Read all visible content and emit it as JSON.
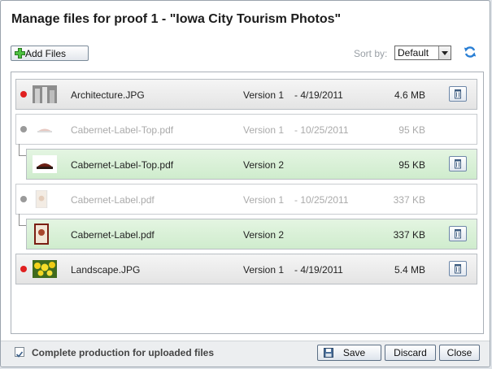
{
  "dialog": {
    "title": "Manage files for proof 1 - \"Iowa City Tourism Photos\""
  },
  "toolbar": {
    "add_files_label": "Add Files",
    "sort_label": "Sort by:",
    "sort_value": "Default"
  },
  "files": [
    {
      "name": "Architecture.JPG",
      "version": "Version 1",
      "date": "-  4/19/2011",
      "size": "4.6 MB",
      "status": "red",
      "state": "current"
    },
    {
      "name": "Cabernet-Label-Top.pdf",
      "version": "Version 1",
      "date": "-  10/25/2011",
      "size": "95 KB",
      "status": "grey",
      "state": "superseded"
    },
    {
      "name": "Cabernet-Label-Top.pdf",
      "version": "Version 2",
      "date": "",
      "size": "95 KB",
      "status": "",
      "state": "new"
    },
    {
      "name": "Cabernet-Label.pdf",
      "version": "Version 1",
      "date": "-  10/25/2011",
      "size": "337 KB",
      "status": "grey",
      "state": "superseded"
    },
    {
      "name": "Cabernet-Label.pdf",
      "version": "Version 2",
      "date": "",
      "size": "337 KB",
      "status": "",
      "state": "new"
    },
    {
      "name": "Landscape.JPG",
      "version": "Version 1",
      "date": "-  4/19/2011",
      "size": "5.4 MB",
      "status": "red",
      "state": "current"
    }
  ],
  "footer": {
    "checkbox_label": "Complete production for uploaded files",
    "checkbox_checked": true,
    "save_label": "Save",
    "discard_label": "Discard",
    "close_label": "Close"
  },
  "colors": {
    "status_red": "#e02020",
    "new_version_green": "#d6efd3",
    "accent_blue": "#2a7fd4"
  },
  "icons": [
    "add-icon",
    "refresh-icon",
    "trash-icon",
    "save-icon",
    "checkbox-icon"
  ]
}
